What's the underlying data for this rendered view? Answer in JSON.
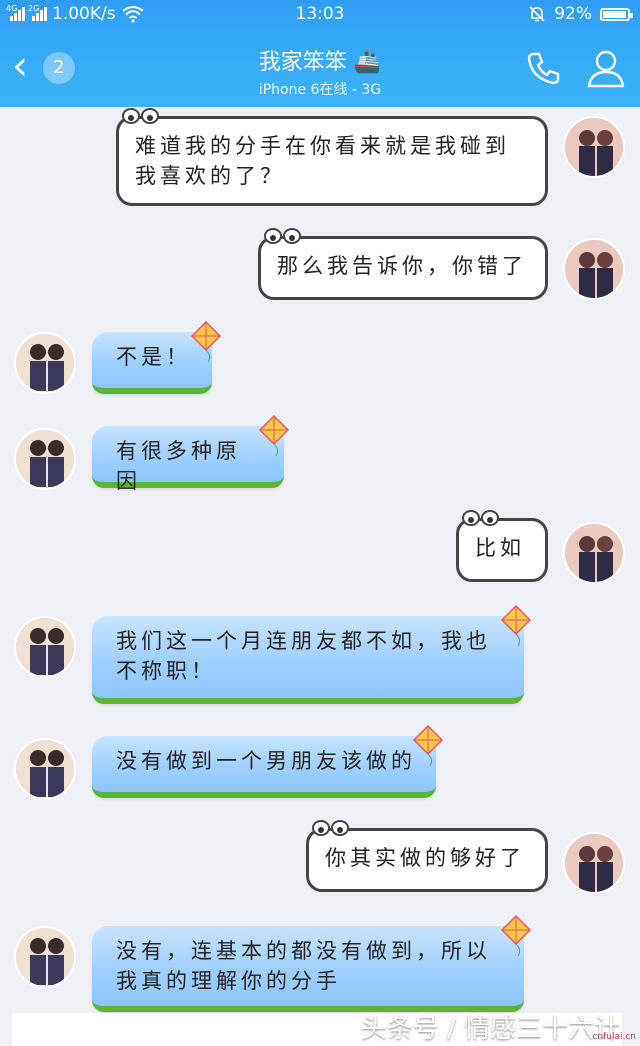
{
  "status_bar": {
    "net_tag_1": "4G",
    "net_tag_2": "2G",
    "speed": "1.00K/s",
    "time": "13:03",
    "battery": "92%",
    "icons": [
      "signal-icon",
      "wifi-icon",
      "alarm-off-icon",
      "battery-icon"
    ]
  },
  "header": {
    "back_icon": "chevron-left-icon",
    "unread_count": "2",
    "title": "我家笨笨",
    "title_emoji": "🚢",
    "subtitle": "iPhone 6在线 - 3G",
    "call_icon": "phone-icon",
    "profile_icon": "user-icon"
  },
  "messages": [
    {
      "from": "self",
      "text": "难道我的分手在你看来就是我碰到我喜欢的了？"
    },
    {
      "from": "self",
      "text": "那么我告诉你，你错了"
    },
    {
      "from": "other",
      "text": "不是！"
    },
    {
      "from": "other",
      "text": "有很多种原因"
    },
    {
      "from": "self",
      "text": "比如"
    },
    {
      "from": "other",
      "text": "我们这一个月连朋友都不如，我也不称职！"
    },
    {
      "from": "other",
      "text": "没有做到一个男朋友该做的"
    },
    {
      "from": "self",
      "text": "你其实做的够好了"
    },
    {
      "from": "other",
      "text": "没有，连基本的都没有做到，所以我真的理解你的分手"
    }
  ],
  "watermark": "头条号 / 情感三十六计",
  "corner_mark": "cnfulai.cn",
  "colors": {
    "header": "#34a6f5",
    "bubble_blue": "#9ed0ff",
    "grass": "#5bb533"
  }
}
